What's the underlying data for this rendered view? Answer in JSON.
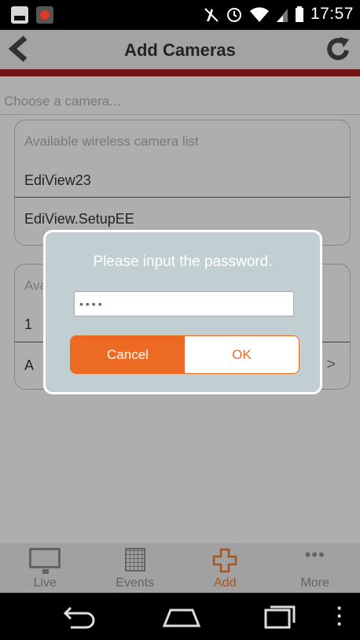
{
  "status_bar": {
    "time": "17:57",
    "icons": [
      "image-icon",
      "app-notification-icon",
      "mute-icon",
      "alarm-icon",
      "wifi-icon",
      "signal-icon",
      "battery-icon"
    ]
  },
  "header": {
    "title": "Add Cameras",
    "back_icon": "chevron-left-icon",
    "refresh_icon": "refresh-icon",
    "accent_color": "#a01d1d"
  },
  "main": {
    "choose_prompt": "Choose a camera...",
    "wireless_panel": {
      "title": "Available wireless camera list",
      "items": [
        "EdiView23",
        "EdiView.SetupEE"
      ]
    },
    "second_panel": {
      "title_partial": "Ava",
      "row1_partial": "1",
      "row2_partial": "A"
    }
  },
  "dialog": {
    "message": "Please input the password.",
    "password_value": "••••",
    "cancel_label": "Cancel",
    "ok_label": "OK",
    "accent_color": "#ec6a24"
  },
  "tabbar": {
    "tabs": [
      {
        "label": "Live",
        "icon": "monitor-icon",
        "active": false
      },
      {
        "label": "Events",
        "icon": "calendar-icon",
        "active": false
      },
      {
        "label": "Add",
        "icon": "add-icon",
        "active": true
      },
      {
        "label": "More",
        "icon": "more-icon",
        "active": false
      }
    ]
  },
  "android_nav": {
    "icons": [
      "back-icon",
      "home-icon",
      "recent-apps-icon",
      "menu-icon"
    ]
  }
}
